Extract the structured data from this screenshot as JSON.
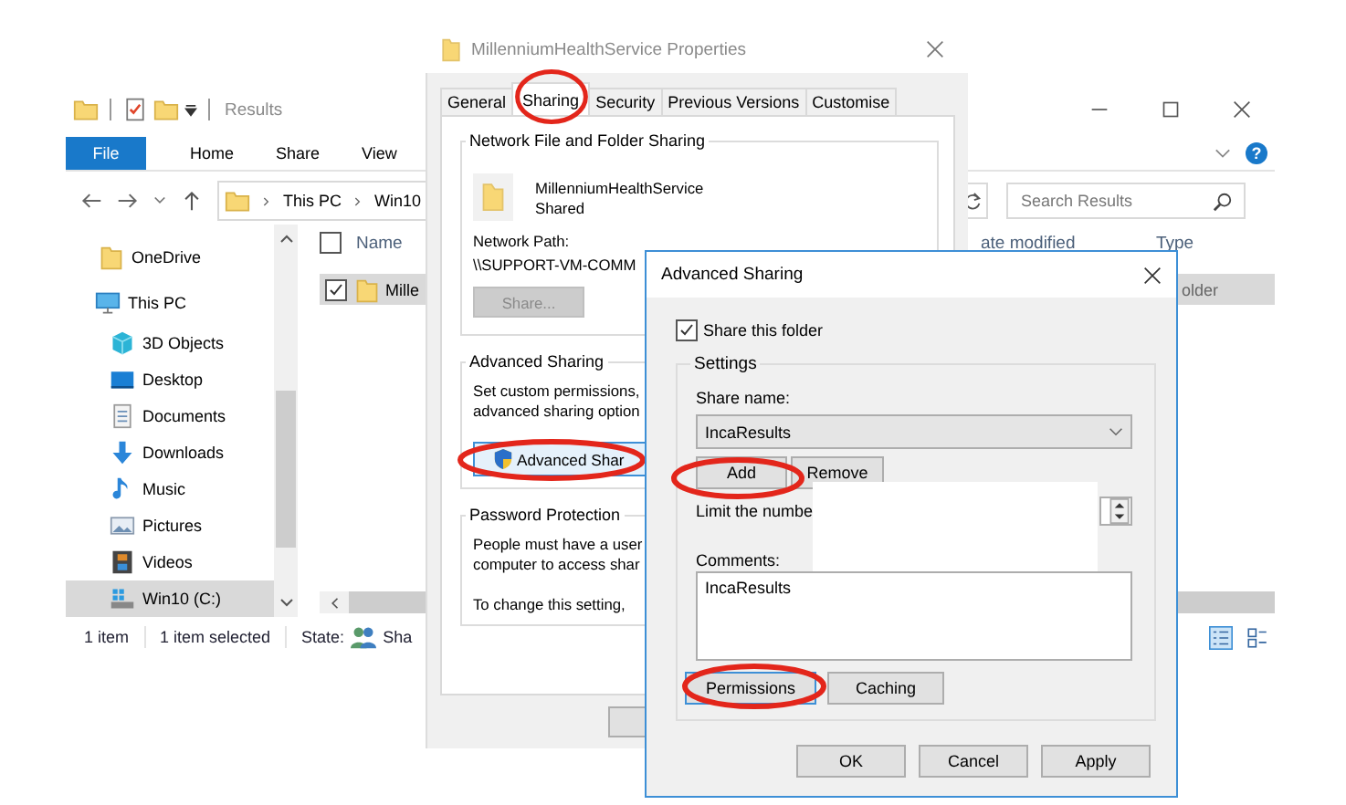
{
  "explorer": {
    "title": "Results",
    "file_tab": "File",
    "ribbon_tabs": [
      "Home",
      "Share",
      "View"
    ],
    "help": "?",
    "address": [
      "This PC",
      "Win10"
    ],
    "search": {
      "placeholder": "Search Results"
    },
    "nav": [
      {
        "label": "OneDrive",
        "selected": false
      },
      {
        "label": "This PC",
        "selected": false,
        "children": [
          {
            "label": "3D Objects",
            "selected": false
          },
          {
            "label": "Desktop",
            "selected": false
          },
          {
            "label": "Documents",
            "selected": false
          },
          {
            "label": "Downloads",
            "selected": false
          },
          {
            "label": "Music",
            "selected": false
          },
          {
            "label": "Pictures",
            "selected": false
          },
          {
            "label": "Videos",
            "selected": false
          },
          {
            "label": "Win10 (C:)",
            "selected": true
          }
        ]
      }
    ],
    "select_all": {
      "checked": false
    },
    "columns": [
      "Name",
      "ate modified",
      "Type"
    ],
    "rows": [
      {
        "name": "Mille",
        "type": "older",
        "checked": true,
        "selected": true
      }
    ],
    "status": {
      "count": "1 item",
      "selection": "1 item selected",
      "state_label": "State:",
      "state_value": "Sha"
    }
  },
  "properties": {
    "title": "MillenniumHealthService Properties",
    "tabs": [
      {
        "label": "General",
        "selected": false
      },
      {
        "label": "Sharing",
        "selected": true
      },
      {
        "label": "Security",
        "selected": false
      },
      {
        "label": "Previous Versions",
        "selected": false
      },
      {
        "label": "Customise",
        "selected": false
      }
    ],
    "network": {
      "title": "Network File and Folder Sharing",
      "folder": "MillenniumHealthService",
      "state": "Shared",
      "path_label": "Network Path:",
      "path": "\\\\SUPPORT-VM-COMM",
      "share_button": {
        "label": "Share...",
        "disabled": true
      }
    },
    "advanced": {
      "title": "Advanced Sharing",
      "lines": [
        "Set custom permissions,",
        "advanced sharing option"
      ],
      "button": "Advanced Shar"
    },
    "password": {
      "title": "Password Protection",
      "lines": [
        "People must have a user",
        "computer to access shar"
      ],
      "note": "To change this setting,"
    }
  },
  "advanced_sharing": {
    "title": "Advanced Sharing",
    "share_folder": {
      "label": "Share this folder",
      "checked": true
    },
    "settings_title": "Settings",
    "share_name_label": "Share name:",
    "share_name": "IncaResults",
    "add": "Add",
    "remove": "Remove",
    "limit_label": "Limit the numbe",
    "comments_label": "Comments:",
    "comments": "IncaResults",
    "permissions": "Permissions",
    "caching": "Caching",
    "footer": [
      "OK",
      "Cancel",
      "Apply"
    ]
  }
}
